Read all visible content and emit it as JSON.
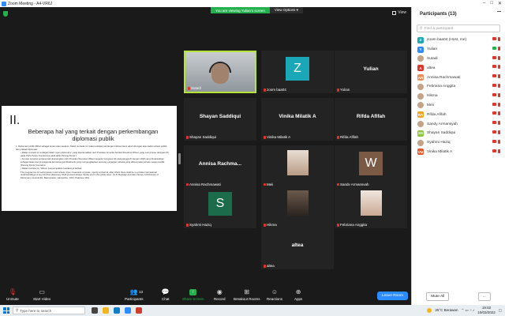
{
  "window": {
    "title": "Zoom Meeting - A4-VR6J",
    "controls": [
      "–",
      "□",
      "✕"
    ]
  },
  "banner": {
    "viewing": "You are viewing Yulian's screen",
    "view_options": "View Options ▾"
  },
  "view_button": "View",
  "slide": {
    "roman": "II.",
    "title": "Beberapa hal yang terkait dengan perkembangan diplomasi publik",
    "items": [
      {
        "text": "1.  Diplomasi publik dilihat sebagai tujuan atau sasaran. Dalam konteks ini maka terdapat pandangan bahwa harus ada hubungan atau kaitan antara publik dan praktek diplomasi.",
        "sub": false
      },
      {
        "text": "•  Dalam konteks ini terdapat istilah \"open diplomacy\" yang diperkenalkan oleh Presiden Amerika Serikat Woodrow Wilson yang menyimpan delegasi AS pada Paris Peace Conference pada akhir Perang Dunia I.",
        "sub": true
      },
      {
        "text": "•  Konsep tersebut pertama kali dicanangkan oleh Presiden Woodrow Wilson kepada Congress AS pada tanggal 8 Januari 1918 yang dimaksudkan sebagai lawan dari propaganda dari kelompok Bolshevik yang mengungkapkan secretsy perjanjian rahasia yang dibuat pada periode sewan konflik (Perang Dunia I) tersebut.",
        "sub": true
      },
      {
        "text": "•  Dalam konteks itu, Wilson menyampaikan keadannya bahwa:",
        "sub": true
      },
      {
        "text": "The programme for world peace must include 'open covenants of peace, openly arrived at, after which there shall be no private international understandings of any kind but diplomacy shall proceed always frankly and in the public view'. (G.R. Berridge and Alan James, A Dictionary of Diplomacy, Houndmills, Basingstoke, Hampshire, 2001: Palgrave 193).",
        "sub": true
      }
    ]
  },
  "tiles": [
    {
      "name": "Sutadi",
      "kind": "video",
      "active": true
    },
    {
      "name": "zoom baa04",
      "kind": "avatar",
      "letter": "Z",
      "color": "#1aa7b8"
    },
    {
      "name": "Yulian",
      "kind": "text",
      "big": "Yulian"
    },
    {
      "name": "Shayan Saddiqui",
      "kind": "text",
      "big": "Shayan Saddiqui"
    },
    {
      "name": "Vinika Milatik A",
      "kind": "text",
      "big": "Vinika Milatik A"
    },
    {
      "name": "Rifda Afifah",
      "kind": "text",
      "big": "Rifda Afifah"
    },
    {
      "name": "Annisa Rachmawati",
      "kind": "text",
      "big": "Annisa  Rachma..."
    },
    {
      "name": "Meii",
      "kind": "photo"
    },
    {
      "name": "Sandy Armansyah",
      "kind": "avatar",
      "letter": "W",
      "color": "#7a5a45"
    },
    {
      "name": "Syahmi Haziq",
      "kind": "avatar",
      "letter": "S",
      "color": "#1c6b4a"
    },
    {
      "name": "Hikma",
      "kind": "photo"
    },
    {
      "name": "Febriana Anggita",
      "kind": "photo"
    },
    {
      "name": "altea",
      "kind": "text",
      "big": "altea"
    }
  ],
  "toolbar": {
    "unmute": "Unmute",
    "start_video": "Start Video",
    "participants": "Participants",
    "participants_count": "13",
    "chat": "Chat",
    "share": "Share Screen",
    "record": "Record",
    "breakout": "Breakout Rooms",
    "reactions": "Reactions",
    "apps": "Apps",
    "leave": "Leave Room"
  },
  "panel": {
    "title": "Participants (13)",
    "search_placeholder": "Find a participant",
    "participants": [
      {
        "name": "zoom baa04 (Host, me)",
        "initial": "Z",
        "color": "#1aa7b8",
        "photo": false
      },
      {
        "name": "Yulian",
        "initial": "Y",
        "color": "#2d8cff",
        "photo": false,
        "video": true
      },
      {
        "name": "Sutadi",
        "initial": "",
        "color": "#c4a38a",
        "photo": true
      },
      {
        "name": "altea",
        "initial": "A",
        "color": "#e0352b",
        "photo": false
      },
      {
        "name": "Annisa Rachmawati",
        "initial": "AR",
        "color": "#f08c5a",
        "photo": false
      },
      {
        "name": "Febriana Anggita",
        "initial": "",
        "color": "#c4a38a",
        "photo": true
      },
      {
        "name": "Hikma",
        "initial": "",
        "color": "#c4a38a",
        "photo": true
      },
      {
        "name": "Meii",
        "initial": "",
        "color": "#c4a38a",
        "photo": true
      },
      {
        "name": "Rifda Afifah",
        "initial": "RA",
        "color": "#f3a31c",
        "photo": false
      },
      {
        "name": "Sandy Armansyah",
        "initial": "",
        "color": "#c4a38a",
        "photo": true
      },
      {
        "name": "Shayan Saddiqui",
        "initial": "SS",
        "color": "#8cc63f",
        "photo": false
      },
      {
        "name": "Syahmi Haziq",
        "initial": "",
        "color": "#c4a38a",
        "photo": true
      },
      {
        "name": "Vinika Milatik A",
        "initial": "VM",
        "color": "#e8562a",
        "photo": false
      }
    ],
    "mute_all": "Mute All",
    "more": "..."
  },
  "taskbar": {
    "search": "Type here to search",
    "weather": "25°C  Berawan",
    "time": "19:02",
    "date": "10/03/2022"
  }
}
